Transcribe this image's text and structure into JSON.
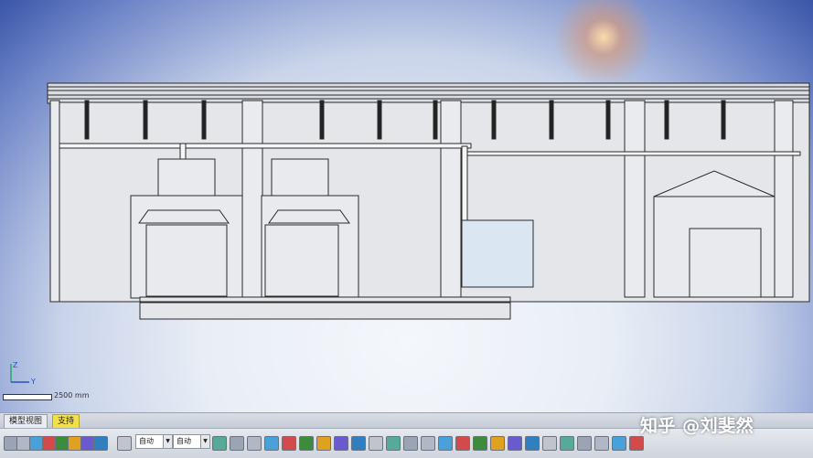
{
  "scale": {
    "label": "2500 mm"
  },
  "axis": {
    "z_label": "Z",
    "y_label": "Y"
  },
  "tabs": [
    {
      "label": "模型视图"
    },
    {
      "label": "支持"
    }
  ],
  "toolbar": {
    "select1": "自动",
    "select2": "自动",
    "icons": [
      "new-icon",
      "open-icon",
      "save-icon",
      "copy-icon",
      "paste-icon",
      "print-icon",
      "render-icon",
      "mesh-icon",
      "axis-icon",
      "globe-icon",
      "render-shaded-icon",
      "hidden-line-icon",
      "wireframe-icon",
      "section-icon",
      "view-front-icon",
      "view-back-icon",
      "view-left-icon",
      "view-right-icon",
      "view-top-icon",
      "view-bottom-icon",
      "isometric-icon",
      "zoom-fit-icon",
      "pan-icon",
      "rotate-icon",
      "measure-icon",
      "grid-icon",
      "layers-icon",
      "color-icon",
      "lights-icon",
      "globe-icon-2",
      "frame-icon",
      "bulb-icon",
      "check-icon",
      "settings-icon"
    ]
  },
  "watermark": "知乎 @刘斐然"
}
